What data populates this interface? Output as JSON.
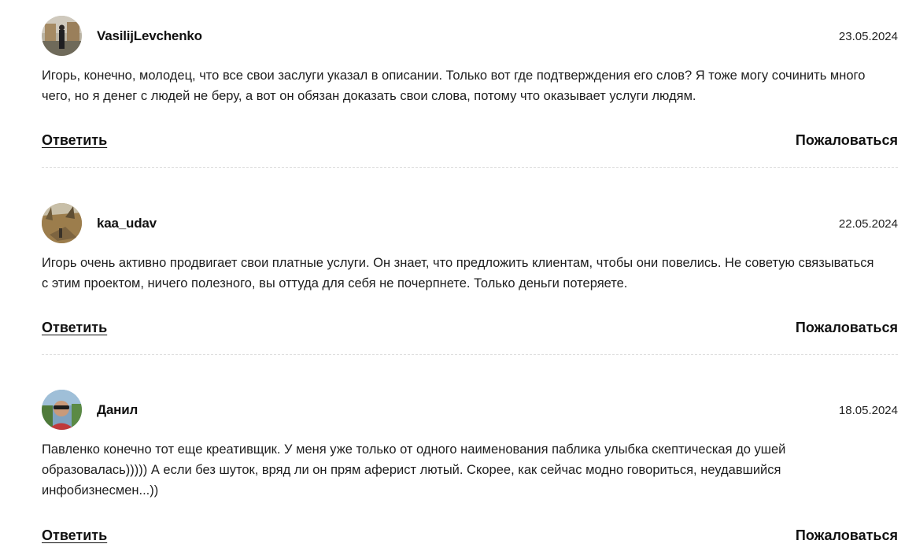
{
  "comments": [
    {
      "author": "VasilijLevchenko",
      "date": "23.05.2024",
      "text": "Игорь, конечно, молодец, что все свои заслуги указал в описании. Только вот где подтверждения его слов? Я тоже могу сочинить много чего, но я денег с людей не беру, а вот он обязан доказать свои слова, потому что оказывает услуги людям.",
      "reply_label": "Ответить",
      "report_label": "Пожаловаться",
      "avatar_icon": "user-photo-avatar"
    },
    {
      "author": "kaa_udav",
      "date": "22.05.2024",
      "text": "Игорь очень активно продвигает свои платные услуги. Он знает, что предложить клиентам, чтобы они повелись. Не советую связываться с этим проектом, ничего полезного, вы оттуда для себя не почерпнете. Только деньги потеряете.",
      "reply_label": "Ответить",
      "report_label": "Пожаловаться",
      "avatar_icon": "user-photo-avatar"
    },
    {
      "author": "Данил",
      "date": "18.05.2024",
      "text": "Павленко конечно тот еще креативщик. У меня уже только от одного наименования паблика улыбка скептическая до ушей образовалась))))) А если без шуток, вряд ли он прям аферист лютый. Скорее, как сейчас модно говориться, неудавшийся инфобизнесмен...))",
      "reply_label": "Ответить",
      "report_label": "Пожаловаться",
      "avatar_icon": "user-photo-avatar"
    }
  ],
  "colors": {
    "text": "#1e1e1e",
    "divider": "#dcdcdc",
    "background": "#ffffff"
  }
}
